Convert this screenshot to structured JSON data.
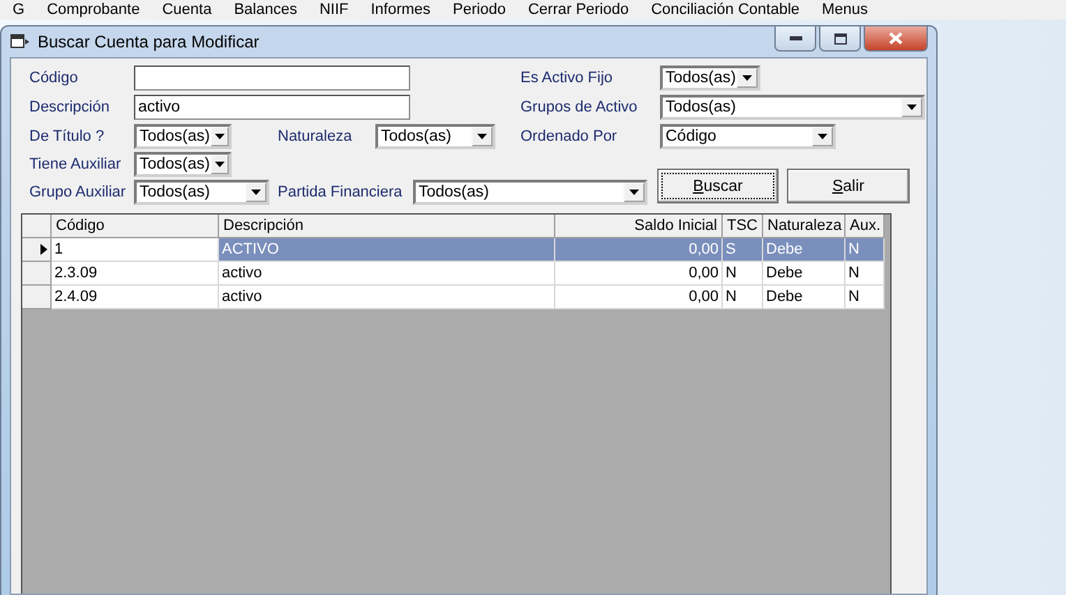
{
  "menu": [
    "G",
    "Comprobante",
    "Cuenta",
    "Balances",
    "NIIF",
    "Informes",
    "Periodo",
    "Cerrar Periodo",
    "Conciliación Contable",
    "Menus"
  ],
  "window": {
    "title": "Buscar Cuenta para Modificar"
  },
  "filters_left": [
    {
      "kind": "input",
      "label": "Código"
    },
    {
      "kind": "input",
      "label": "Descripción",
      "value": "activo"
    },
    {
      "kind": "combo",
      "label": "De Título ?",
      "value": "Todos(as)",
      "extra_label": "Naturaleza",
      "extra_value": "Todos(as)"
    },
    {
      "kind": "combo",
      "label": "Tiene Auxiliar",
      "value": "Todos(as)"
    },
    {
      "kind": "combo_wide",
      "label": "Grupo Auxiliar",
      "value": "Todos(as)",
      "extra_label": "Partida Financiera",
      "extra_value": "Todos(as)"
    }
  ],
  "filters_right": [
    {
      "label": "Es Activo Fijo",
      "value": "Todos(as)"
    },
    {
      "label": "Grupos de Activo",
      "value": "Todos(as)"
    },
    {
      "label": "Ordenado Por",
      "value": "Código"
    }
  ],
  "buttons": [
    {
      "label": "Buscar",
      "focused": true
    },
    {
      "label": "Salir",
      "focused": false
    }
  ],
  "table": {
    "columns": [
      "Código",
      "Descripción",
      "Saldo Inicial",
      "TSC",
      "Naturaleza",
      "Aux."
    ],
    "rows": [
      {
        "cells": [
          "1",
          "ACTIVO",
          "0,00",
          "S",
          "Debe",
          "N"
        ],
        "selected": true
      },
      {
        "cells": [
          "2.3.09",
          "activo",
          "0,00",
          "N",
          "Debe",
          "N"
        ],
        "selected": false
      },
      {
        "cells": [
          "2.4.09",
          "activo",
          "0,00",
          "N",
          "Debe",
          "N"
        ],
        "selected": false
      }
    ]
  }
}
